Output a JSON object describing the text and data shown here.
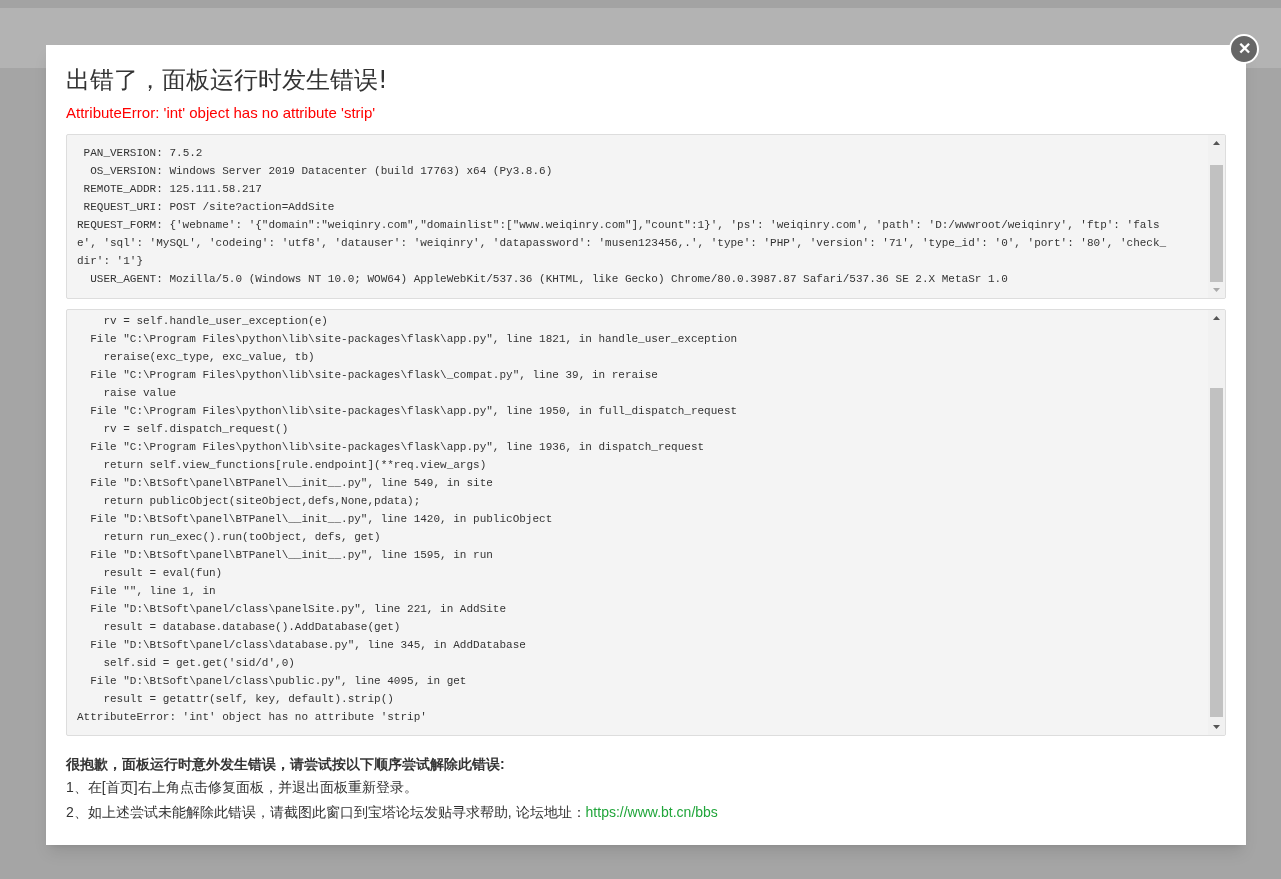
{
  "dialog": {
    "title": "出错了，面板运行时发生错误!",
    "error": "AttributeError: 'int' object has no attribute 'strip'",
    "request_info": [
      " PAN_VERSION: 7.5.2",
      "  OS_VERSION: Windows Server 2019 Datacenter (build 17763) x64 (Py3.8.6)",
      " REMOTE_ADDR: 125.111.58.217",
      " REQUEST_URI: POST /site?action=AddSite",
      "REQUEST_FORM: {'webname': '{\"domain\":\"weiqinry.com\",\"domainlist\":[\"www.weiqinry.com\"],\"count\":1}', 'ps': 'weiqinry.com', 'path': 'D:/wwwroot/weiqinry', 'ftp': 'false', 'sql': 'MySQL', 'codeing': 'utf8', 'datauser': 'weiqinry', 'datapassword': 'musen123456,.', 'type': 'PHP', 'version': '71', 'type_id': '0', 'port': '80', 'check_dir': '1'}",
      "  USER_AGENT: Mozilla/5.0 (Windows NT 10.0; WOW64) AppleWebKit/537.36 (KHTML, like Gecko) Chrome/80.0.3987.87 Safari/537.36 SE 2.X MetaSr 1.0"
    ],
    "traceback": [
      "    rv = self.handle_user_exception(e)",
      "  File \"C:\\Program Files\\python\\lib\\site-packages\\flask\\app.py\", line 1821, in handle_user_exception",
      "    reraise(exc_type, exc_value, tb)",
      "  File \"C:\\Program Files\\python\\lib\\site-packages\\flask\\_compat.py\", line 39, in reraise",
      "    raise value",
      "  File \"C:\\Program Files\\python\\lib\\site-packages\\flask\\app.py\", line 1950, in full_dispatch_request",
      "    rv = self.dispatch_request()",
      "  File \"C:\\Program Files\\python\\lib\\site-packages\\flask\\app.py\", line 1936, in dispatch_request",
      "    return self.view_functions[rule.endpoint](**req.view_args)",
      "  File \"D:\\BtSoft\\panel\\BTPanel\\__init__.py\", line 549, in site",
      "    return publicObject(siteObject,defs,None,pdata);",
      "  File \"D:\\BtSoft\\panel\\BTPanel\\__init__.py\", line 1420, in publicObject",
      "    return run_exec().run(toObject, defs, get)",
      "  File \"D:\\BtSoft\\panel\\BTPanel\\__init__.py\", line 1595, in run",
      "    result = eval(fun)",
      "  File \"\", line 1, in",
      "  File \"D:\\BtSoft\\panel/class\\panelSite.py\", line 221, in AddSite",
      "    result = database.database().AddDatabase(get)",
      "  File \"D:\\BtSoft\\panel/class\\database.py\", line 345, in AddDatabase",
      "    self.sid = get.get('sid/d',0)",
      "  File \"D:\\BtSoft\\panel/class\\public.py\", line 4095, in get",
      "    result = getattr(self, key, default).strip()",
      "AttributeError: 'int' object has no attribute 'strip'"
    ],
    "help": {
      "heading": "很抱歉，面板运行时意外发生错误，请尝试按以下顺序尝试解除此错误:",
      "steps": [
        {
          "text": "1、在[首页]右上角点击修复面板，并退出面板重新登录。"
        },
        {
          "text": "2、如上述尝试未能解除此错误，请截图此窗口到宝塔论坛发贴寻求帮助, 论坛地址：",
          "link": "https://www.bt.cn/bbs"
        }
      ]
    },
    "close_button": {
      "glyph": "✕"
    }
  }
}
